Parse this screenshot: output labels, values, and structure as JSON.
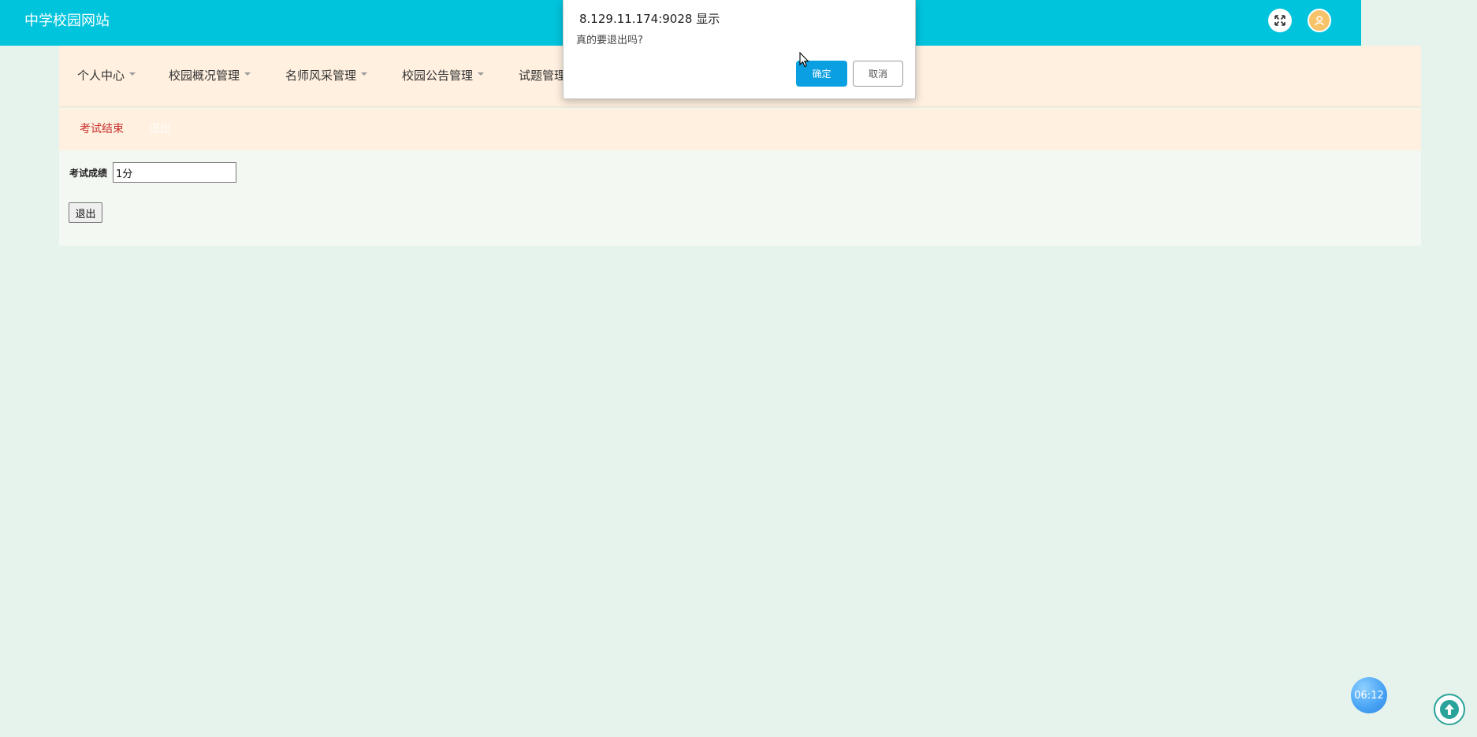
{
  "header": {
    "site_title": "中学校园网站",
    "fullscreen_icon": "expand-arrows-icon",
    "user_icon": "user-icon"
  },
  "nav": {
    "items": [
      {
        "label": "个人中心"
      },
      {
        "label": "校园概况管理"
      },
      {
        "label": "名师风采管理"
      },
      {
        "label": "校园公告管理"
      },
      {
        "label": "试题管理"
      }
    ]
  },
  "subbar": {
    "active": "考试结束",
    "faded": "退出"
  },
  "panel": {
    "score_label": "考试成绩",
    "score_value": "1分",
    "exit_label": "退出"
  },
  "dialog": {
    "origin": "8.129.11.174:9028 显示",
    "message": "真的要退出吗?",
    "ok_label": "确定",
    "cancel_label": "取消"
  },
  "timer": {
    "value": "06:12"
  },
  "colors": {
    "header": "#00c4dc",
    "nav_bg": "#fff0e0",
    "page_bg": "#e5f3ec",
    "ok_button": "#0a9fe0",
    "active_sub": "#c9302c"
  }
}
